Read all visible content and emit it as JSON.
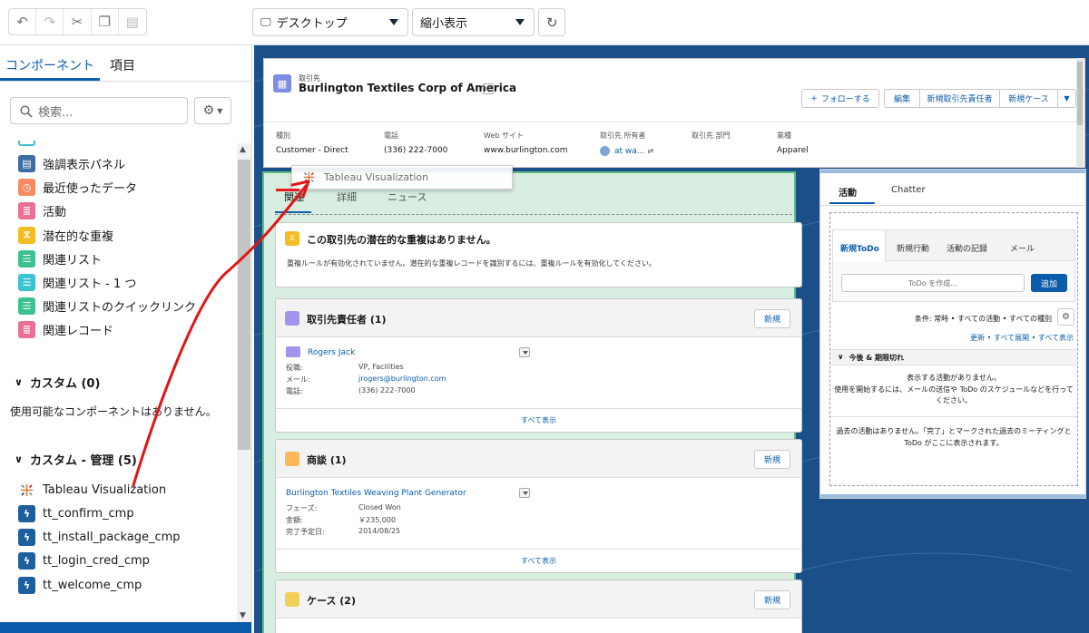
{
  "toolbar": {
    "device_select": "デスクトップ",
    "zoom_select": "縮小表示"
  },
  "left_panel": {
    "tabs": [
      "コンポーネント",
      "項目"
    ],
    "search_placeholder": "検索...",
    "components": [
      {
        "label": "強調表示パネル",
        "icon": "highlights-panel-icon",
        "color": "#3a6ea5"
      },
      {
        "label": "最近使ったデータ",
        "icon": "recent-icon",
        "color": "#f88962"
      },
      {
        "label": "活動",
        "icon": "activity-icon",
        "color": "#eb7092"
      },
      {
        "label": "潜在的な重複",
        "icon": "duplicates-icon",
        "color": "#f4bc25"
      },
      {
        "label": "関連リスト",
        "icon": "related-list-icon",
        "color": "#3cc28e"
      },
      {
        "label": "関連リスト - 1 つ",
        "icon": "related-list-single-icon",
        "color": "#3cc2d0"
      },
      {
        "label": "関連リストのクイックリンク",
        "icon": "related-quicklinks-icon",
        "color": "#3cc28e"
      },
      {
        "label": "関連レコード",
        "icon": "related-record-icon",
        "color": "#eb7092"
      }
    ],
    "custom_section": {
      "title": "カスタム (0)",
      "empty_text": "使用可能なコンポーネントはありません。"
    },
    "managed_section": {
      "title": "カスタム - 管理 (5)",
      "items": [
        {
          "label": "Tableau Visualization",
          "icon": "tableau-icon"
        },
        {
          "label": "tt_confirm_cmp",
          "icon": "lightning-icon"
        },
        {
          "label": "tt_install_package_cmp",
          "icon": "lightning-icon"
        },
        {
          "label": "tt_login_cred_cmp",
          "icon": "lightning-icon"
        },
        {
          "label": "tt_welcome_cmp",
          "icon": "lightning-icon"
        }
      ]
    }
  },
  "record": {
    "object_label": "取引先",
    "name": "Burlington Textiles Corp of America",
    "actions": [
      "フォローする",
      "編集",
      "新規取引先責任者",
      "新規ケース"
    ],
    "fields": [
      {
        "label": "種別",
        "value": "Customer - Direct"
      },
      {
        "label": "電話",
        "value": "(336) 222-7000"
      },
      {
        "label": "Web サイト",
        "value": "www.burlington.com"
      },
      {
        "label": "取引先 所有者",
        "value": "at wa..."
      },
      {
        "label": "取引先 部門",
        "value": ""
      },
      {
        "label": "業種",
        "value": "Apparel"
      }
    ]
  },
  "drag_ghost": "Tableau Visualization",
  "main_tabs": [
    "関連",
    "詳細",
    "ニュース"
  ],
  "duplicates_card": {
    "title": "この取引先の潜在的な重複はありません。",
    "body": "重複ルールが有効化されていません。潜在的な重複レコードを識別するには、重複ルールを有効化してください。"
  },
  "contacts_card": {
    "title": "取引先責任者 (1)",
    "new_label": "新規",
    "contact_name": "Rogers Jack",
    "rows": [
      {
        "label": "役職:",
        "value": "VP, Facilities"
      },
      {
        "label": "メール:",
        "value": "jrogers@burlington.com"
      },
      {
        "label": "電話:",
        "value": "(336) 222-7000"
      }
    ],
    "view_all": "すべて表示"
  },
  "opps_card": {
    "title": "商談 (1)",
    "new_label": "新規",
    "opp_name": "Burlington Textiles Weaving Plant Generator",
    "rows": [
      {
        "label": "フェーズ:",
        "value": "Closed Won"
      },
      {
        "label": "金額:",
        "value": "￥235,000"
      },
      {
        "label": "完了予定日:",
        "value": "2014/08/25"
      }
    ],
    "view_all": "すべて表示"
  },
  "cases_card": {
    "title": "ケース (2)",
    "new_label": "新規"
  },
  "activity": {
    "tabs": [
      "活動",
      "Chatter"
    ],
    "subtabs": [
      "新規ToDo",
      "新規行動",
      "活動の記録",
      "メール"
    ],
    "todo_placeholder": "ToDo を作成...",
    "add_label": "追加",
    "filter_text": "条件: 常時 • すべての活動 • すべての種別",
    "links": "更新 • すべて展開 • すべて表示",
    "upcoming_title": "今後 & 期限切れ",
    "upcoming_empty_1": "表示する活動がありません。",
    "upcoming_empty_2": "使用を開始するには、メールの送信や ToDo のスケジュールなどを行ってください。",
    "past_empty": "過去の活動はありません。「完了」とマークされた過去のミーティングと ToDo がここに表示されます。"
  }
}
